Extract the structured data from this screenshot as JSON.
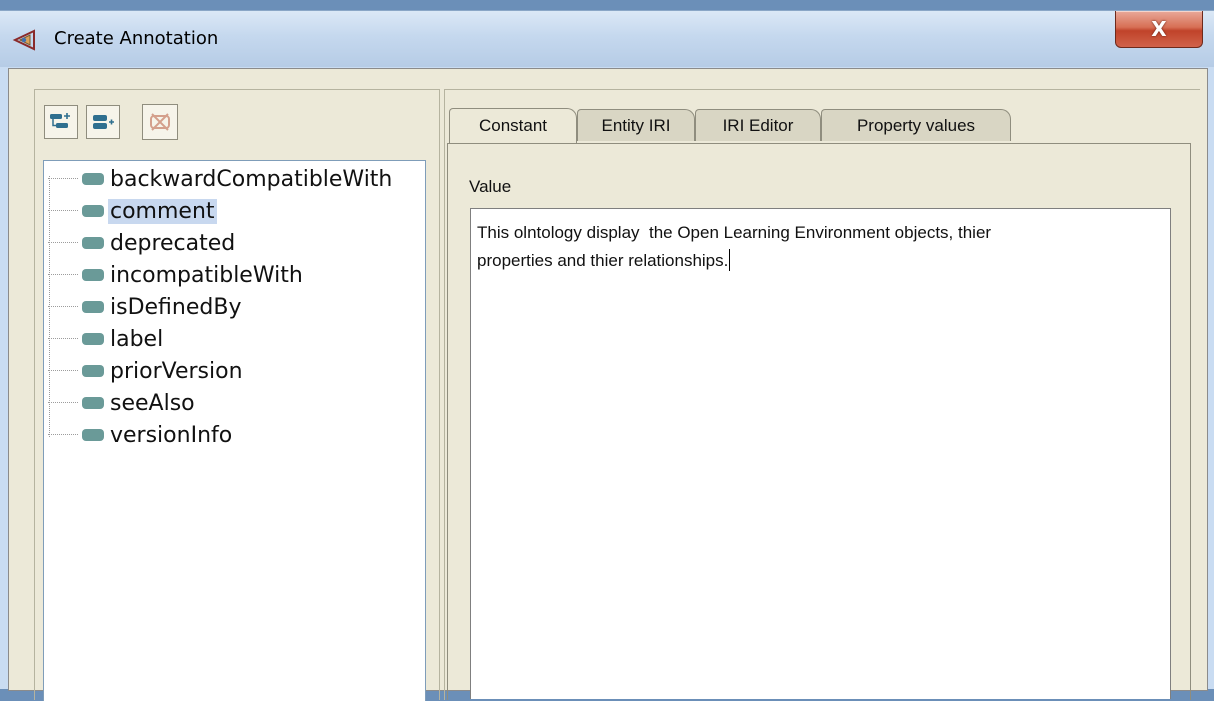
{
  "window": {
    "title": "Create Annotation",
    "close_label": "X"
  },
  "toolbar": {
    "buttons": [
      {
        "icon": "add-subproperty-icon"
      },
      {
        "icon": "add-sibling-property-icon"
      },
      {
        "icon": "delete-property-icon"
      }
    ]
  },
  "tree": {
    "items": [
      {
        "label": "backwardCompatibleWith"
      },
      {
        "label": "comment",
        "selected": true
      },
      {
        "label": "deprecated"
      },
      {
        "label": "incompatibleWith"
      },
      {
        "label": "isDefinedBy"
      },
      {
        "label": "label"
      },
      {
        "label": "priorVersion"
      },
      {
        "label": "seeAlso"
      },
      {
        "label": "versionInfo"
      }
    ]
  },
  "tabs": [
    {
      "label": "Constant",
      "active": true
    },
    {
      "label": "Entity IRI"
    },
    {
      "label": "IRI Editor"
    },
    {
      "label": "Property values"
    }
  ],
  "editor": {
    "value_label": "Value",
    "value_text": "This olntology display  the Open Learning Environment objects, thier\nproperties and thier relationships."
  },
  "colors": {
    "title_bar": "#c5d8ee",
    "close_button": "#c0432a",
    "panel_bg": "#ece9d8",
    "selection": "#c8d8ef",
    "tree_icon": "#6a9a98"
  }
}
